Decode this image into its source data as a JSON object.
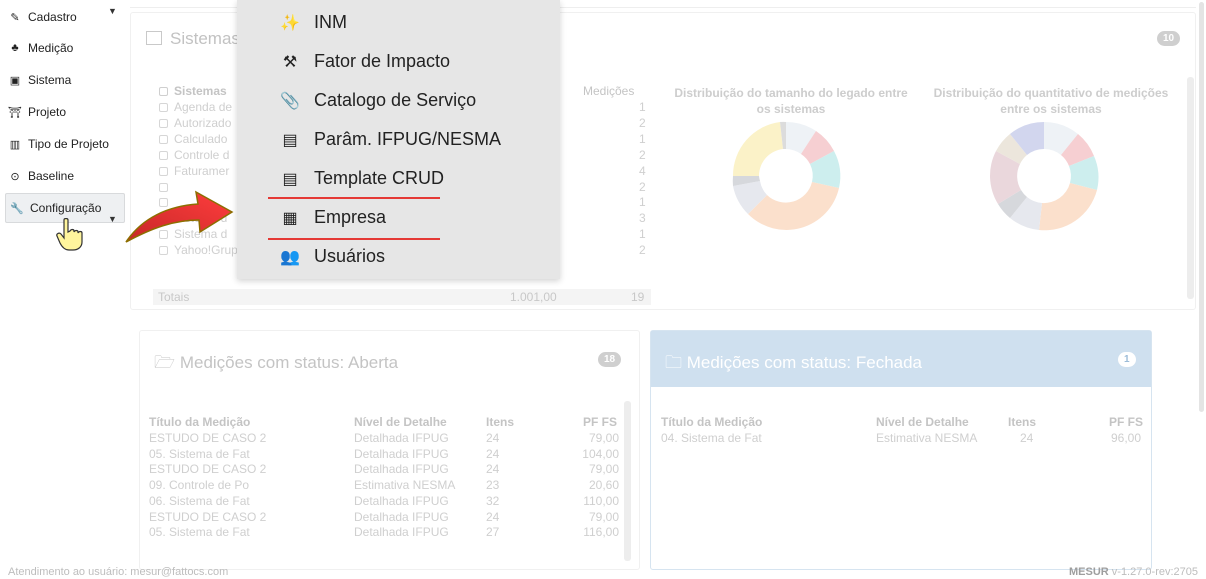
{
  "sidebar": {
    "items": [
      {
        "label": "Cadastro",
        "icon": "pencil-icon"
      },
      {
        "label": "Medição",
        "icon": "cubes-icon"
      },
      {
        "label": "Sistema",
        "icon": "screen-icon"
      },
      {
        "label": "Projeto",
        "icon": "bank-icon"
      },
      {
        "label": "Tipo de Projeto",
        "icon": "sitemap-icon"
      },
      {
        "label": "Baseline",
        "icon": "circle-dot-icon"
      },
      {
        "label": "Configuração",
        "icon": "wrench-icon"
      }
    ]
  },
  "dropdown": {
    "items": [
      {
        "label": "INM",
        "icon": "magic-wand-icon"
      },
      {
        "label": "Fator de Impacto",
        "icon": "gavel-icon"
      },
      {
        "label": "Catalogo de Serviço",
        "icon": "paperclip-icon"
      },
      {
        "label": "Parâm. IFPUG/NESMA",
        "icon": "list-icon"
      },
      {
        "label": "Template CRUD",
        "icon": "list-icon"
      },
      {
        "label": "Empresa",
        "icon": "building-icon"
      },
      {
        "label": "Usuários",
        "icon": "users-icon"
      }
    ]
  },
  "systems_panel": {
    "title": "Sistemas",
    "badge": "10",
    "col_sistemas": "Sistemas",
    "col_medicoes": "Medições",
    "rows": [
      {
        "name": "Agenda de",
        "medicoes": "1"
      },
      {
        "name": "Autorizado",
        "medicoes": "2"
      },
      {
        "name": "Calculado",
        "medicoes": "1"
      },
      {
        "name": "Controle d",
        "medicoes": "2"
      },
      {
        "name": "Faturamer",
        "medicoes": "4"
      },
      {
        "name": "",
        "medicoes": "2"
      },
      {
        "name": "",
        "medicoes": "1"
      },
      {
        "name": "Sistema d",
        "medicoes": "3"
      },
      {
        "name": "Sistema d",
        "medicoes": "1"
      },
      {
        "name": "Yahoo!Grupos",
        "medicoes": "2"
      }
    ],
    "totals_label": "Totais",
    "totals_value": "1.001,00",
    "totals_count": "19",
    "chart1_title": "Distribuição do tamanho do legado entre os sistemas",
    "chart2_title": "Distribuição do quantitativo de medições entre os sistemas"
  },
  "open_panel": {
    "title": "Medições com status: Aberta",
    "badge": "18",
    "headers": [
      "Título da Medição",
      "Nível de Detalhe",
      "Itens",
      "PF FS"
    ],
    "rows": [
      [
        "ESTUDO DE CASO 2",
        "Detalhada IFPUG",
        "24",
        "79,00"
      ],
      [
        "05. Sistema de Fat",
        "Detalhada IFPUG",
        "24",
        "104,00"
      ],
      [
        "ESTUDO DE CASO 2",
        "Detalhada IFPUG",
        "24",
        "79,00"
      ],
      [
        "09. Controle de Po",
        "Estimativa NESMA",
        "23",
        "20,60"
      ],
      [
        "06. Sistema de Fat",
        "Detalhada IFPUG",
        "32",
        "110,00"
      ],
      [
        "ESTUDO DE CASO 2",
        "Detalhada IFPUG",
        "24",
        "79,00"
      ],
      [
        "05. Sistema de Fat",
        "Detalhada IFPUG",
        "27",
        "116,00"
      ]
    ]
  },
  "closed_panel": {
    "title": "Medições com status: Fechada",
    "badge": "1",
    "headers": [
      "Título da Medição",
      "Nível de Detalhe",
      "Itens",
      "PF FS"
    ],
    "rows": [
      [
        "04. Sistema de Fat",
        "Estimativa NESMA",
        "24",
        "96,00"
      ]
    ]
  },
  "footer": {
    "left": "Atendimento ao usuário: mesur@fattocs.com",
    "brand": "MESUR",
    "version": "v-1.27.0-rev:2705"
  },
  "colors": {
    "menu_bg": "#e6e6e6",
    "highlight_line": "#e53935",
    "arrow": "#e53935",
    "closed_header": "#cfe0ef"
  }
}
